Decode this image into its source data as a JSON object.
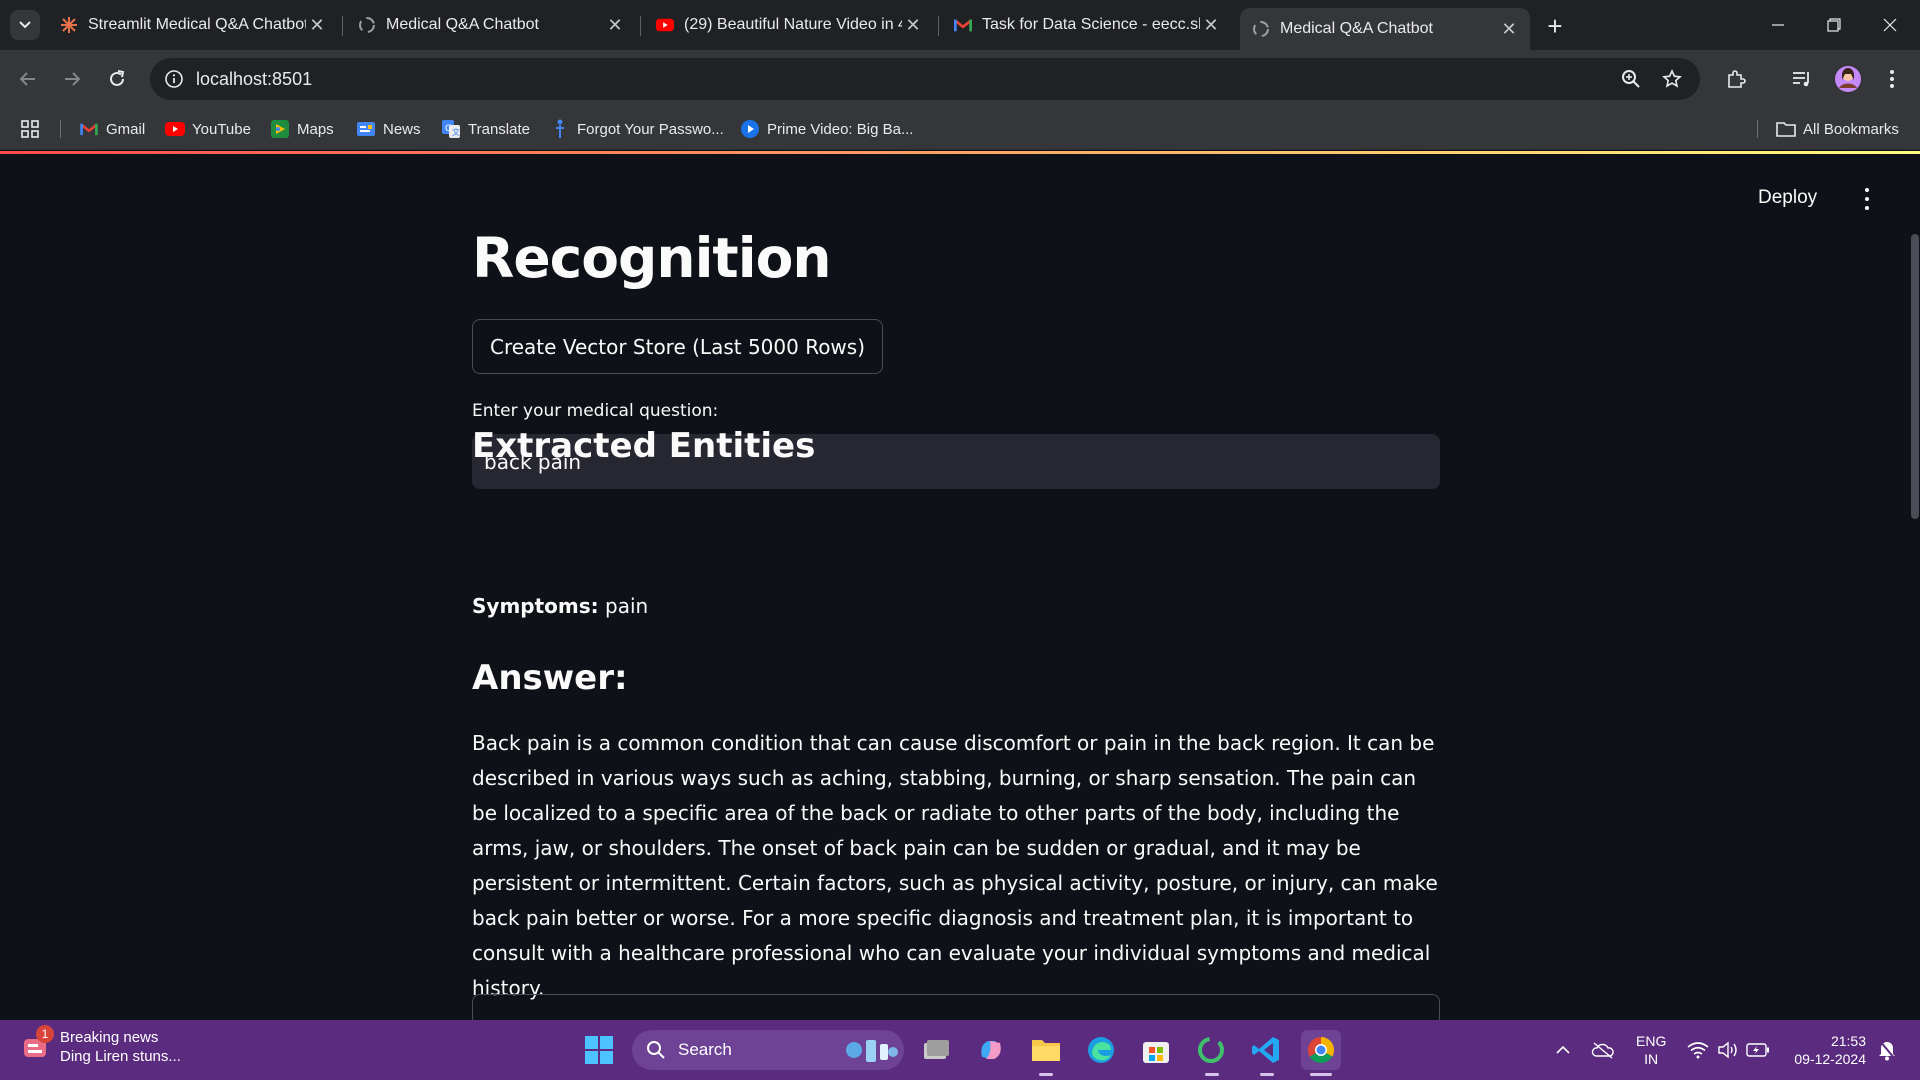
{
  "browser": {
    "tabs": [
      {
        "title": "Streamlit Medical Q&A Chatbot",
        "icon": "streamlit-burst-icon",
        "active": false
      },
      {
        "title": "Medical Q&A Chatbot",
        "icon": "loading-spinner-icon",
        "active": false
      },
      {
        "title": "(29) Beautiful Nature Video in 4",
        "icon": "youtube-icon",
        "active": false
      },
      {
        "title": "Task for Data Science - eecc.shl",
        "icon": "gmail-icon",
        "active": false
      },
      {
        "title": "Medical Q&A Chatbot",
        "icon": "loading-spinner-icon",
        "active": true
      }
    ],
    "url": "localhost:8501",
    "bookmarks": [
      {
        "label": "Gmail",
        "icon": "gmail-icon"
      },
      {
        "label": "YouTube",
        "icon": "youtube-icon"
      },
      {
        "label": "Maps",
        "icon": "maps-icon"
      },
      {
        "label": "News",
        "icon": "google-news-icon"
      },
      {
        "label": "Translate",
        "icon": "google-translate-icon"
      },
      {
        "label": "Forgot Your Passwo...",
        "icon": "figure-icon"
      },
      {
        "label": "Prime Video: Big Ba...",
        "icon": "prime-video-icon"
      }
    ],
    "all_bookmarks": "All Bookmarks"
  },
  "app": {
    "deploy": "Deploy",
    "title": "Recognition",
    "vector_button": "Create Vector Store (Last 5000 Rows)",
    "question_label": "Enter your medical question:",
    "question_value": "back pain",
    "entities_heading": "Extracted Entities",
    "symptoms_label": "Symptoms:",
    "symptoms_value": "pain",
    "answer_heading": "Answer:",
    "answer_text": "Back pain is a common condition that can cause discomfort or pain in the back region. It can be described in various ways such as aching, stabbing, burning, or sharp sensation. The pain can be localized to a specific area of the back or radiate to other parts of the body, including the arms, jaw, or shoulders. The onset of back pain can be sudden or gradual, and it may be persistent or intermittent. Certain factors, such as physical activity, posture, or injury, can make back pain better or worse. For a more specific diagnosis and treatment plan, it is important to consult with a healthcare professional who can evaluate your individual symptoms and medical history.",
    "accent_color": "#ff4b4b"
  },
  "taskbar": {
    "news_badge": "1",
    "news_title": "Breaking news",
    "news_subtitle": "Ding Liren stuns...",
    "search_placeholder": "Search",
    "lang_top": "ENG",
    "lang_bottom": "IN",
    "time": "21:53",
    "date": "09-12-2024",
    "color": "#5a2b7e"
  }
}
